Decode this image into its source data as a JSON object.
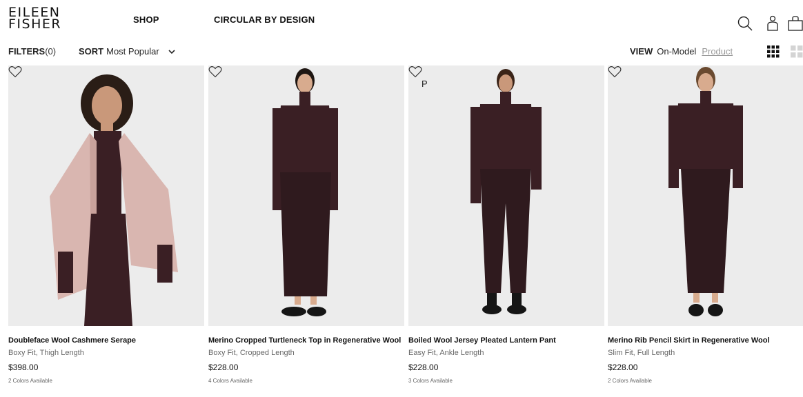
{
  "header": {
    "logo_line1": "EILEEN",
    "logo_line2": "FISHER",
    "nav": {
      "shop": "SHOP",
      "circular": "CIRCULAR BY DESIGN"
    }
  },
  "toolbar": {
    "filters_label": "FILTERS",
    "filters_count": "(0)",
    "sort_label": "SORT",
    "sort_value": "Most Popular",
    "view_label": "VIEW",
    "view_on_model": "On-Model",
    "view_product": "Product"
  },
  "products": [
    {
      "name": "Doubleface Wool Cashmere Serape",
      "fit": "Boxy Fit, Thigh Length",
      "price": "$398.00",
      "colors": "2 Colors Available"
    },
    {
      "name": "Merino Cropped Turtleneck Top in Regenerative Wool",
      "fit": "Boxy Fit, Cropped Length",
      "price": "$228.00",
      "colors": "4 Colors Available"
    },
    {
      "name": "Boiled Wool Jersey Pleated Lantern Pant",
      "fit": "Easy Fit, Ankle Length",
      "price": "$228.00",
      "colors": "3 Colors Available",
      "badge": "P"
    },
    {
      "name": "Merino Rib Pencil Skirt in Regenerative Wool",
      "fit": "Slim Fit, Full Length",
      "price": "$228.00",
      "colors": "2 Colors Available"
    }
  ],
  "colors": {
    "photo_bg": "#ececec",
    "garment_plum": "#3a1f24",
    "serape_pink": "#d9b6b0",
    "skin": "#c9987a",
    "hair": "#2a1d16"
  }
}
